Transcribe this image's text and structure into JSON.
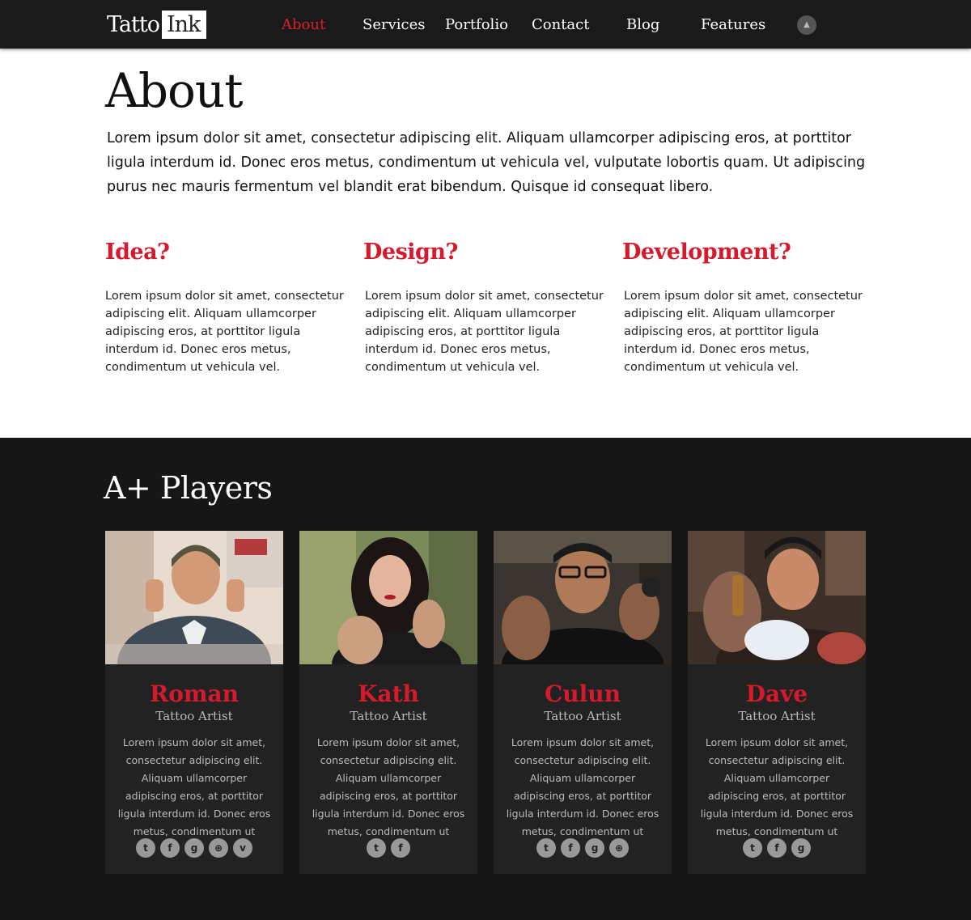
{
  "header": {
    "logo_part1": "Tatto",
    "logo_part2": "Ink",
    "nav": [
      "About",
      "Services",
      "Portfolio",
      "Contact",
      "Blog",
      "Features"
    ],
    "active_nav": "About",
    "up_icon": "chevron-up-icon"
  },
  "about": {
    "title": "About",
    "intro": "Lorem ipsum dolor sit amet, consectetur adipiscing elit. Aliquam ullamcorper adipiscing eros, at porttitor ligula interdum id. Donec eros metus, condimentum ut vehicula vel, vulputate lobortis quam. Ut adipiscing purus nec mauris fermentum vel blandit erat bibendum. Quisque id consequat libero.",
    "columns": [
      {
        "title": "Idea?",
        "text": "Lorem ipsum dolor sit amet, consectetur adipiscing elit. Aliquam ullamcorper adipiscing eros, at porttitor ligula interdum id. Donec eros metus, condimentum ut vehicula vel."
      },
      {
        "title": "Design?",
        "text": "Lorem ipsum dolor sit amet, consectetur adipiscing elit. Aliquam ullamcorper adipiscing eros, at porttitor ligula interdum id. Donec eros metus, condimentum ut vehicula vel."
      },
      {
        "title": "Development?",
        "text": "Lorem ipsum dolor sit amet, consectetur adipiscing elit. Aliquam ullamcorper adipiscing eros, at porttitor ligula interdum id. Donec eros metus, condimentum ut vehicula vel."
      }
    ]
  },
  "players": {
    "title": "A+ Players",
    "members": [
      {
        "name": "Roman",
        "role": "Tattoo Artist",
        "bio": "Lorem ipsum dolor sit amet, consectetur adipiscing elit. Aliquam ullamcorper adipiscing eros, at porttitor ligula interdum id. Donec eros metus, condimentum ut",
        "socials": [
          "twitter-icon",
          "facebook-icon",
          "google-plus-icon",
          "dribbble-icon",
          "vimeo-icon"
        ]
      },
      {
        "name": "Kath",
        "role": "Tattoo Artist",
        "bio": "Lorem ipsum dolor sit amet, consectetur adipiscing elit. Aliquam ullamcorper adipiscing eros, at porttitor ligula interdum id. Donec eros metus, condimentum ut",
        "socials": [
          "twitter-icon",
          "facebook-icon"
        ]
      },
      {
        "name": "Culun",
        "role": "Tattoo Artist",
        "bio": "Lorem ipsum dolor sit amet, consectetur adipiscing elit. Aliquam ullamcorper adipiscing eros, at porttitor ligula interdum id. Donec eros metus, condimentum ut",
        "socials": [
          "twitter-icon",
          "facebook-icon",
          "google-plus-icon",
          "dribbble-icon"
        ]
      },
      {
        "name": "Dave",
        "role": "Tattoo Artist",
        "bio": "Lorem ipsum dolor sit amet, consectetur adipiscing elit. Aliquam ullamcorper adipiscing eros, at porttitor ligula interdum id. Donec eros metus, condimentum ut",
        "socials": [
          "twitter-icon",
          "facebook-icon",
          "google-plus-icon"
        ]
      }
    ]
  },
  "colors": {
    "accent": "#d41a2c",
    "header_bg": "#1a1a1a",
    "dark_bg": "#161616",
    "card_bg": "#222222"
  }
}
